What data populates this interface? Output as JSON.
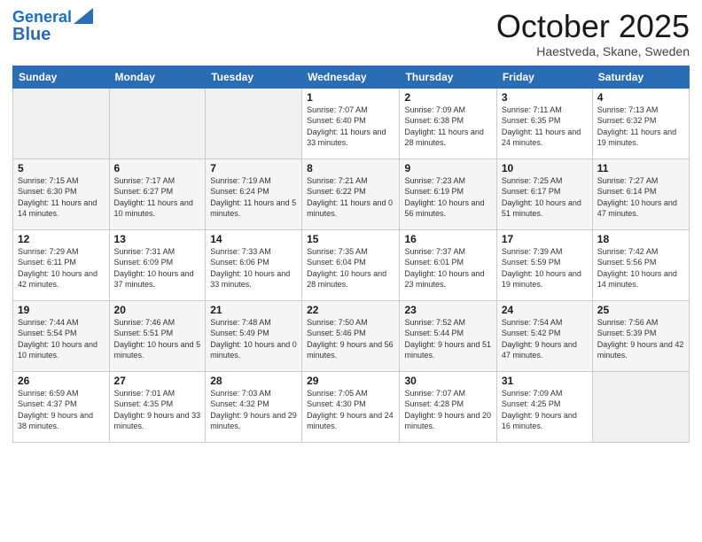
{
  "header": {
    "logo_line1": "General",
    "logo_line2": "Blue",
    "month": "October 2025",
    "location": "Haestveda, Skane, Sweden"
  },
  "days_of_week": [
    "Sunday",
    "Monday",
    "Tuesday",
    "Wednesday",
    "Thursday",
    "Friday",
    "Saturday"
  ],
  "weeks": [
    [
      {
        "day": "",
        "sunrise": "",
        "sunset": "",
        "daylight": "",
        "empty": true
      },
      {
        "day": "",
        "sunrise": "",
        "sunset": "",
        "daylight": "",
        "empty": true
      },
      {
        "day": "",
        "sunrise": "",
        "sunset": "",
        "daylight": "",
        "empty": true
      },
      {
        "day": "1",
        "sunrise": "Sunrise: 7:07 AM",
        "sunset": "Sunset: 6:40 PM",
        "daylight": "Daylight: 11 hours and 33 minutes."
      },
      {
        "day": "2",
        "sunrise": "Sunrise: 7:09 AM",
        "sunset": "Sunset: 6:38 PM",
        "daylight": "Daylight: 11 hours and 28 minutes."
      },
      {
        "day": "3",
        "sunrise": "Sunrise: 7:11 AM",
        "sunset": "Sunset: 6:35 PM",
        "daylight": "Daylight: 11 hours and 24 minutes."
      },
      {
        "day": "4",
        "sunrise": "Sunrise: 7:13 AM",
        "sunset": "Sunset: 6:32 PM",
        "daylight": "Daylight: 11 hours and 19 minutes."
      }
    ],
    [
      {
        "day": "5",
        "sunrise": "Sunrise: 7:15 AM",
        "sunset": "Sunset: 6:30 PM",
        "daylight": "Daylight: 11 hours and 14 minutes."
      },
      {
        "day": "6",
        "sunrise": "Sunrise: 7:17 AM",
        "sunset": "Sunset: 6:27 PM",
        "daylight": "Daylight: 11 hours and 10 minutes."
      },
      {
        "day": "7",
        "sunrise": "Sunrise: 7:19 AM",
        "sunset": "Sunset: 6:24 PM",
        "daylight": "Daylight: 11 hours and 5 minutes."
      },
      {
        "day": "8",
        "sunrise": "Sunrise: 7:21 AM",
        "sunset": "Sunset: 6:22 PM",
        "daylight": "Daylight: 11 hours and 0 minutes."
      },
      {
        "day": "9",
        "sunrise": "Sunrise: 7:23 AM",
        "sunset": "Sunset: 6:19 PM",
        "daylight": "Daylight: 10 hours and 56 minutes."
      },
      {
        "day": "10",
        "sunrise": "Sunrise: 7:25 AM",
        "sunset": "Sunset: 6:17 PM",
        "daylight": "Daylight: 10 hours and 51 minutes."
      },
      {
        "day": "11",
        "sunrise": "Sunrise: 7:27 AM",
        "sunset": "Sunset: 6:14 PM",
        "daylight": "Daylight: 10 hours and 47 minutes."
      }
    ],
    [
      {
        "day": "12",
        "sunrise": "Sunrise: 7:29 AM",
        "sunset": "Sunset: 6:11 PM",
        "daylight": "Daylight: 10 hours and 42 minutes."
      },
      {
        "day": "13",
        "sunrise": "Sunrise: 7:31 AM",
        "sunset": "Sunset: 6:09 PM",
        "daylight": "Daylight: 10 hours and 37 minutes."
      },
      {
        "day": "14",
        "sunrise": "Sunrise: 7:33 AM",
        "sunset": "Sunset: 6:06 PM",
        "daylight": "Daylight: 10 hours and 33 minutes."
      },
      {
        "day": "15",
        "sunrise": "Sunrise: 7:35 AM",
        "sunset": "Sunset: 6:04 PM",
        "daylight": "Daylight: 10 hours and 28 minutes."
      },
      {
        "day": "16",
        "sunrise": "Sunrise: 7:37 AM",
        "sunset": "Sunset: 6:01 PM",
        "daylight": "Daylight: 10 hours and 23 minutes."
      },
      {
        "day": "17",
        "sunrise": "Sunrise: 7:39 AM",
        "sunset": "Sunset: 5:59 PM",
        "daylight": "Daylight: 10 hours and 19 minutes."
      },
      {
        "day": "18",
        "sunrise": "Sunrise: 7:42 AM",
        "sunset": "Sunset: 5:56 PM",
        "daylight": "Daylight: 10 hours and 14 minutes."
      }
    ],
    [
      {
        "day": "19",
        "sunrise": "Sunrise: 7:44 AM",
        "sunset": "Sunset: 5:54 PM",
        "daylight": "Daylight: 10 hours and 10 minutes."
      },
      {
        "day": "20",
        "sunrise": "Sunrise: 7:46 AM",
        "sunset": "Sunset: 5:51 PM",
        "daylight": "Daylight: 10 hours and 5 minutes."
      },
      {
        "day": "21",
        "sunrise": "Sunrise: 7:48 AM",
        "sunset": "Sunset: 5:49 PM",
        "daylight": "Daylight: 10 hours and 0 minutes."
      },
      {
        "day": "22",
        "sunrise": "Sunrise: 7:50 AM",
        "sunset": "Sunset: 5:46 PM",
        "daylight": "Daylight: 9 hours and 56 minutes."
      },
      {
        "day": "23",
        "sunrise": "Sunrise: 7:52 AM",
        "sunset": "Sunset: 5:44 PM",
        "daylight": "Daylight: 9 hours and 51 minutes."
      },
      {
        "day": "24",
        "sunrise": "Sunrise: 7:54 AM",
        "sunset": "Sunset: 5:42 PM",
        "daylight": "Daylight: 9 hours and 47 minutes."
      },
      {
        "day": "25",
        "sunrise": "Sunrise: 7:56 AM",
        "sunset": "Sunset: 5:39 PM",
        "daylight": "Daylight: 9 hours and 42 minutes."
      }
    ],
    [
      {
        "day": "26",
        "sunrise": "Sunrise: 6:59 AM",
        "sunset": "Sunset: 4:37 PM",
        "daylight": "Daylight: 9 hours and 38 minutes."
      },
      {
        "day": "27",
        "sunrise": "Sunrise: 7:01 AM",
        "sunset": "Sunset: 4:35 PM",
        "daylight": "Daylight: 9 hours and 33 minutes."
      },
      {
        "day": "28",
        "sunrise": "Sunrise: 7:03 AM",
        "sunset": "Sunset: 4:32 PM",
        "daylight": "Daylight: 9 hours and 29 minutes."
      },
      {
        "day": "29",
        "sunrise": "Sunrise: 7:05 AM",
        "sunset": "Sunset: 4:30 PM",
        "daylight": "Daylight: 9 hours and 24 minutes."
      },
      {
        "day": "30",
        "sunrise": "Sunrise: 7:07 AM",
        "sunset": "Sunset: 4:28 PM",
        "daylight": "Daylight: 9 hours and 20 minutes."
      },
      {
        "day": "31",
        "sunrise": "Sunrise: 7:09 AM",
        "sunset": "Sunset: 4:25 PM",
        "daylight": "Daylight: 9 hours and 16 minutes."
      },
      {
        "day": "",
        "sunrise": "",
        "sunset": "",
        "daylight": "",
        "empty": true
      }
    ]
  ]
}
